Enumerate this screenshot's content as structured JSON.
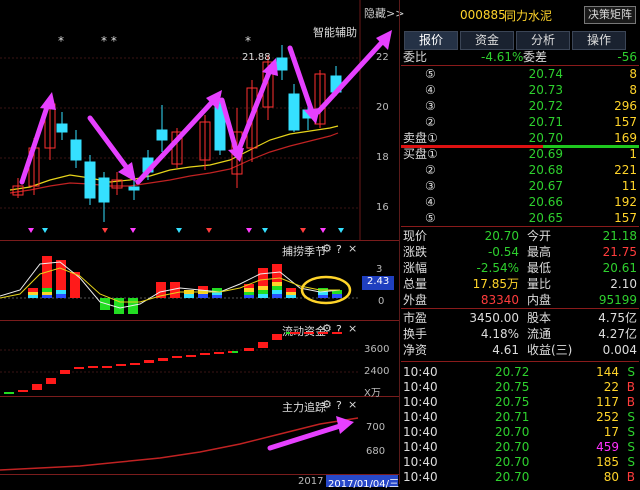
{
  "header": {
    "hide_label": "隐藏>>",
    "indicator_label": "智能辅助",
    "stock_code": "000885",
    "stock_name": "同力水泥",
    "decision_button": "决策矩阵"
  },
  "tabs": [
    "报价",
    "资金",
    "分析",
    "操作"
  ],
  "price_chart": {
    "y_ticks": [
      "22",
      "20",
      "18",
      "16"
    ],
    "high_label": "21.88",
    "stars": [
      "*",
      "* *",
      "*"
    ]
  },
  "indicator1": {
    "title": "捕捞季节",
    "y_ticks": [
      "3",
      "0"
    ],
    "value_badge": "2.43"
  },
  "indicator2": {
    "title": "流动资金",
    "y_ticks": [
      "3600",
      "2400"
    ],
    "unit": "X万"
  },
  "indicator3": {
    "title": "主力追踪",
    "y_ticks": [
      "700",
      "680"
    ]
  },
  "panel_icons": {
    "gear": "⚙",
    "help": "?",
    "close": "×"
  },
  "bottom_axis": {
    "year": "2017",
    "date": "2017/01/04/三"
  },
  "quote": {
    "weibi": {
      "label": "委比",
      "value": "-4.61%",
      "label2": "委差",
      "value2": "-56"
    },
    "sell": [
      {
        "label": "⑤",
        "price": "20.74",
        "vol": "8"
      },
      {
        "label": "④",
        "price": "20.73",
        "vol": "8"
      },
      {
        "label": "③",
        "price": "20.72",
        "vol": "296"
      },
      {
        "label": "②",
        "price": "20.71",
        "vol": "157"
      },
      {
        "label": "卖盘①",
        "price": "20.70",
        "vol": "169"
      }
    ],
    "buy": [
      {
        "label": "买盘①",
        "price": "20.69",
        "vol": "1"
      },
      {
        "label": "②",
        "price": "20.68",
        "vol": "221"
      },
      {
        "label": "③",
        "price": "20.67",
        "vol": "11"
      },
      {
        "label": "④",
        "price": "20.66",
        "vol": "192"
      },
      {
        "label": "⑤",
        "price": "20.65",
        "vol": "157"
      }
    ],
    "stats": [
      {
        "l1": "现价",
        "v1": "20.70",
        "c1": "green",
        "l2": "今开",
        "v2": "21.18",
        "c2": "green"
      },
      {
        "l1": "涨跌",
        "v1": "-0.54",
        "c1": "green",
        "l2": "最高",
        "v2": "21.75",
        "c2": "red"
      },
      {
        "l1": "涨幅",
        "v1": "-2.54%",
        "c1": "green",
        "l2": "最低",
        "v2": "20.61",
        "c2": "green"
      },
      {
        "l1": "总量",
        "v1": "17.85万",
        "c1": "yellow",
        "l2": "量比",
        "v2": "2.10",
        "c2": "white"
      },
      {
        "l1": "外盘",
        "v1": "83340",
        "c1": "red",
        "l2": "内盘",
        "v2": "95199",
        "c2": "green"
      }
    ],
    "stats2": [
      {
        "l1": "市盈",
        "v1": "3450.00",
        "l2": "股本",
        "v2": "4.75亿"
      },
      {
        "l1": "换手",
        "v1": "4.18%",
        "l2": "流通",
        "v2": "4.27亿"
      },
      {
        "l1": "净资",
        "v1": "4.61",
        "l2": "收益(三)",
        "v2": "0.004"
      }
    ]
  },
  "trades": [
    {
      "time": "10:40",
      "price": "20.72",
      "vol": "144",
      "side": "S",
      "vc": "yellow",
      "sc": "green"
    },
    {
      "time": "10:40",
      "price": "20.75",
      "vol": "22",
      "side": "B",
      "vc": "yellow",
      "sc": "red"
    },
    {
      "time": "10:40",
      "price": "20.75",
      "vol": "117",
      "side": "B",
      "vc": "yellow",
      "sc": "red"
    },
    {
      "time": "10:40",
      "price": "20.71",
      "vol": "252",
      "side": "S",
      "vc": "yellow",
      "sc": "green"
    },
    {
      "time": "10:40",
      "price": "20.70",
      "vol": "17",
      "side": "S",
      "vc": "yellow",
      "sc": "green"
    },
    {
      "time": "10:40",
      "price": "20.70",
      "vol": "459",
      "side": "S",
      "vc": "magenta",
      "sc": "green"
    },
    {
      "time": "10:40",
      "price": "20.70",
      "vol": "185",
      "side": "S",
      "vc": "yellow",
      "sc": "green"
    },
    {
      "time": "10:40",
      "price": "20.70",
      "vol": "80",
      "side": "B",
      "vc": "yellow",
      "sc": "red"
    }
  ]
}
